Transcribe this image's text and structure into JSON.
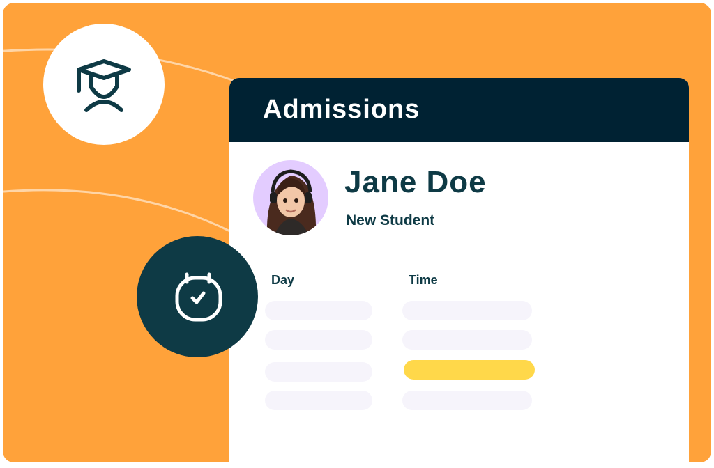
{
  "card": {
    "title": "Admissions",
    "student_name": "Jane Doe",
    "student_role": "New Student"
  },
  "schedule": {
    "day_label": "Day",
    "time_label": "Time",
    "day_slots": [
      {
        "selected": false
      },
      {
        "selected": false
      },
      {
        "selected": false
      },
      {
        "selected": false
      }
    ],
    "time_slots": [
      {
        "selected": false
      },
      {
        "selected": false
      },
      {
        "selected": true
      },
      {
        "selected": false
      }
    ]
  },
  "icons": {
    "student": "graduate-student-icon",
    "calendar": "calendar-check-icon"
  },
  "colors": {
    "background": "#FFA23A",
    "header": "#002233",
    "text_dark": "#0E3A45",
    "slot": "#F6F4FB",
    "slot_selected": "#FFD84A",
    "avatar_bg": "#E3CCFF"
  }
}
